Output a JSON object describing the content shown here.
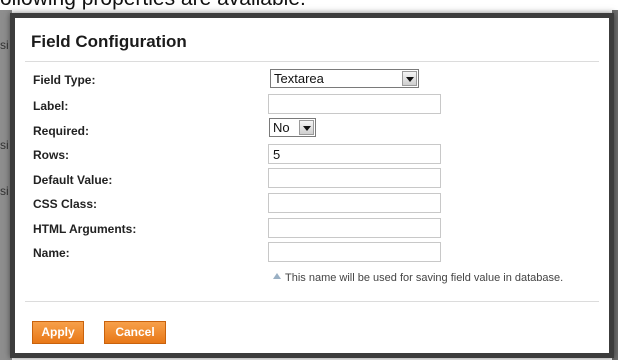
{
  "background": {
    "heading_fragment": "ollowing properties are available:",
    "side_letters": [
      "si",
      "si",
      "si"
    ]
  },
  "dialog": {
    "title": "Field Configuration",
    "fields": {
      "field_type": {
        "label": "Field Type:",
        "value": "Textarea"
      },
      "label": {
        "label": "Label:",
        "value": ""
      },
      "required": {
        "label": "Required:",
        "value": "No"
      },
      "rows": {
        "label": "Rows:",
        "value": "5"
      },
      "default_value": {
        "label": "Default Value:",
        "value": ""
      },
      "css_class": {
        "label": "CSS Class:",
        "value": ""
      },
      "html_arguments": {
        "label": "HTML Arguments:",
        "value": ""
      },
      "name": {
        "label": "Name:",
        "value": ""
      }
    },
    "hint": "This name will be used for saving field value in database.",
    "buttons": {
      "apply": "Apply",
      "cancel": "Cancel"
    }
  },
  "colors": {
    "button_orange": "#e87817",
    "dialog_border": "#3c3c3c"
  }
}
